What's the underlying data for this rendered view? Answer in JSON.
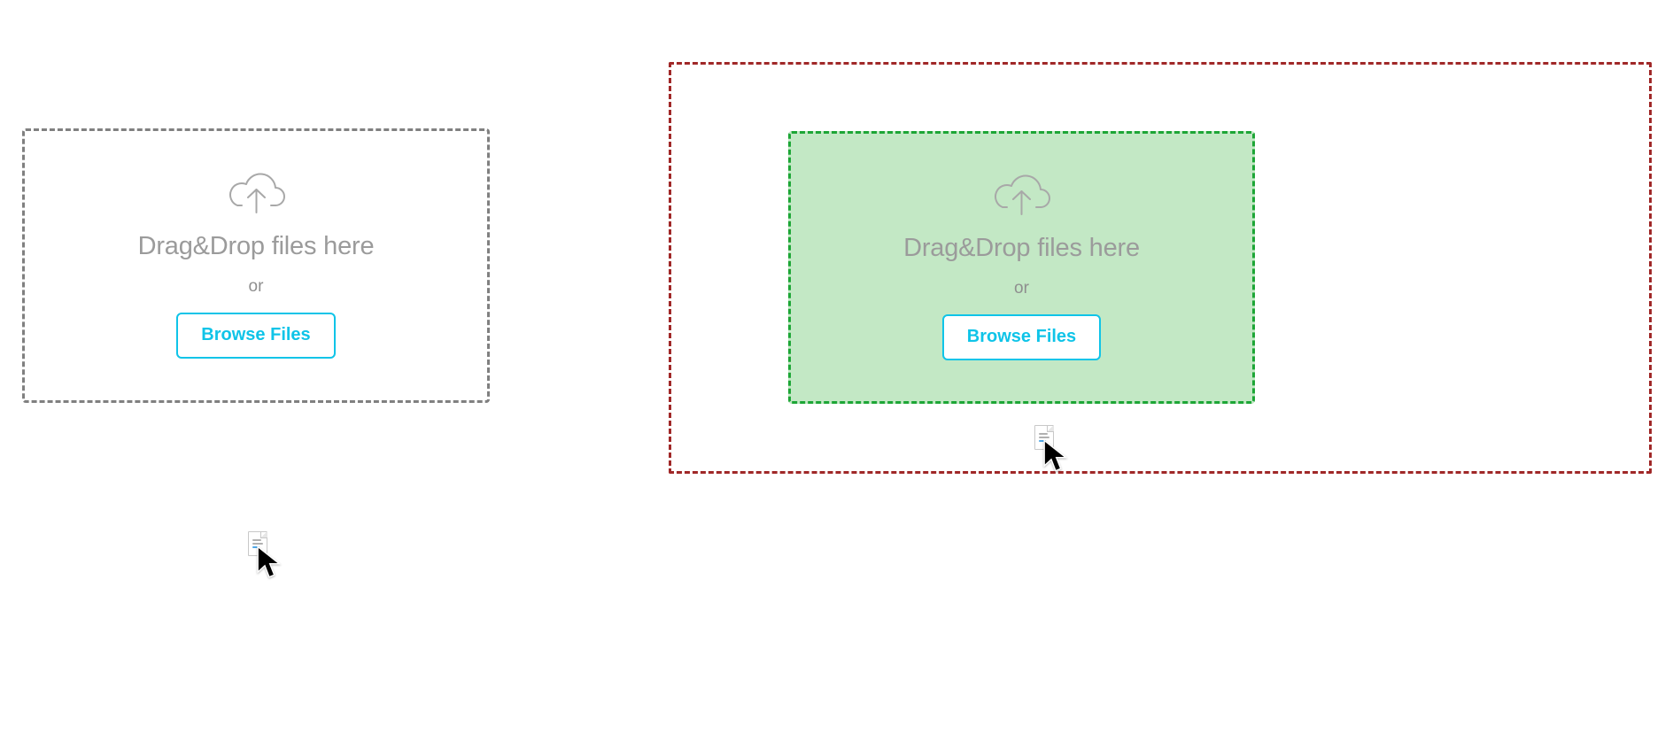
{
  "dropzone_default": {
    "headline": "Drag&Drop files here",
    "or_label": "or",
    "browse_label": "Browse Files"
  },
  "dropzone_highlight": {
    "headline": "Drag&Drop files here",
    "or_label": "or",
    "browse_label": "Browse Files"
  },
  "icons": {
    "cloud_upload": "cloud-upload-icon",
    "file_drag_cursor": "file-drag-cursor-icon"
  },
  "colors": {
    "border_default": "#808080",
    "border_highlight": "#1da636",
    "fill_highlight": "#c3e8c5",
    "border_margin": "#a02828",
    "accent": "#0fc4e8",
    "text_muted": "#9b9b9b"
  }
}
